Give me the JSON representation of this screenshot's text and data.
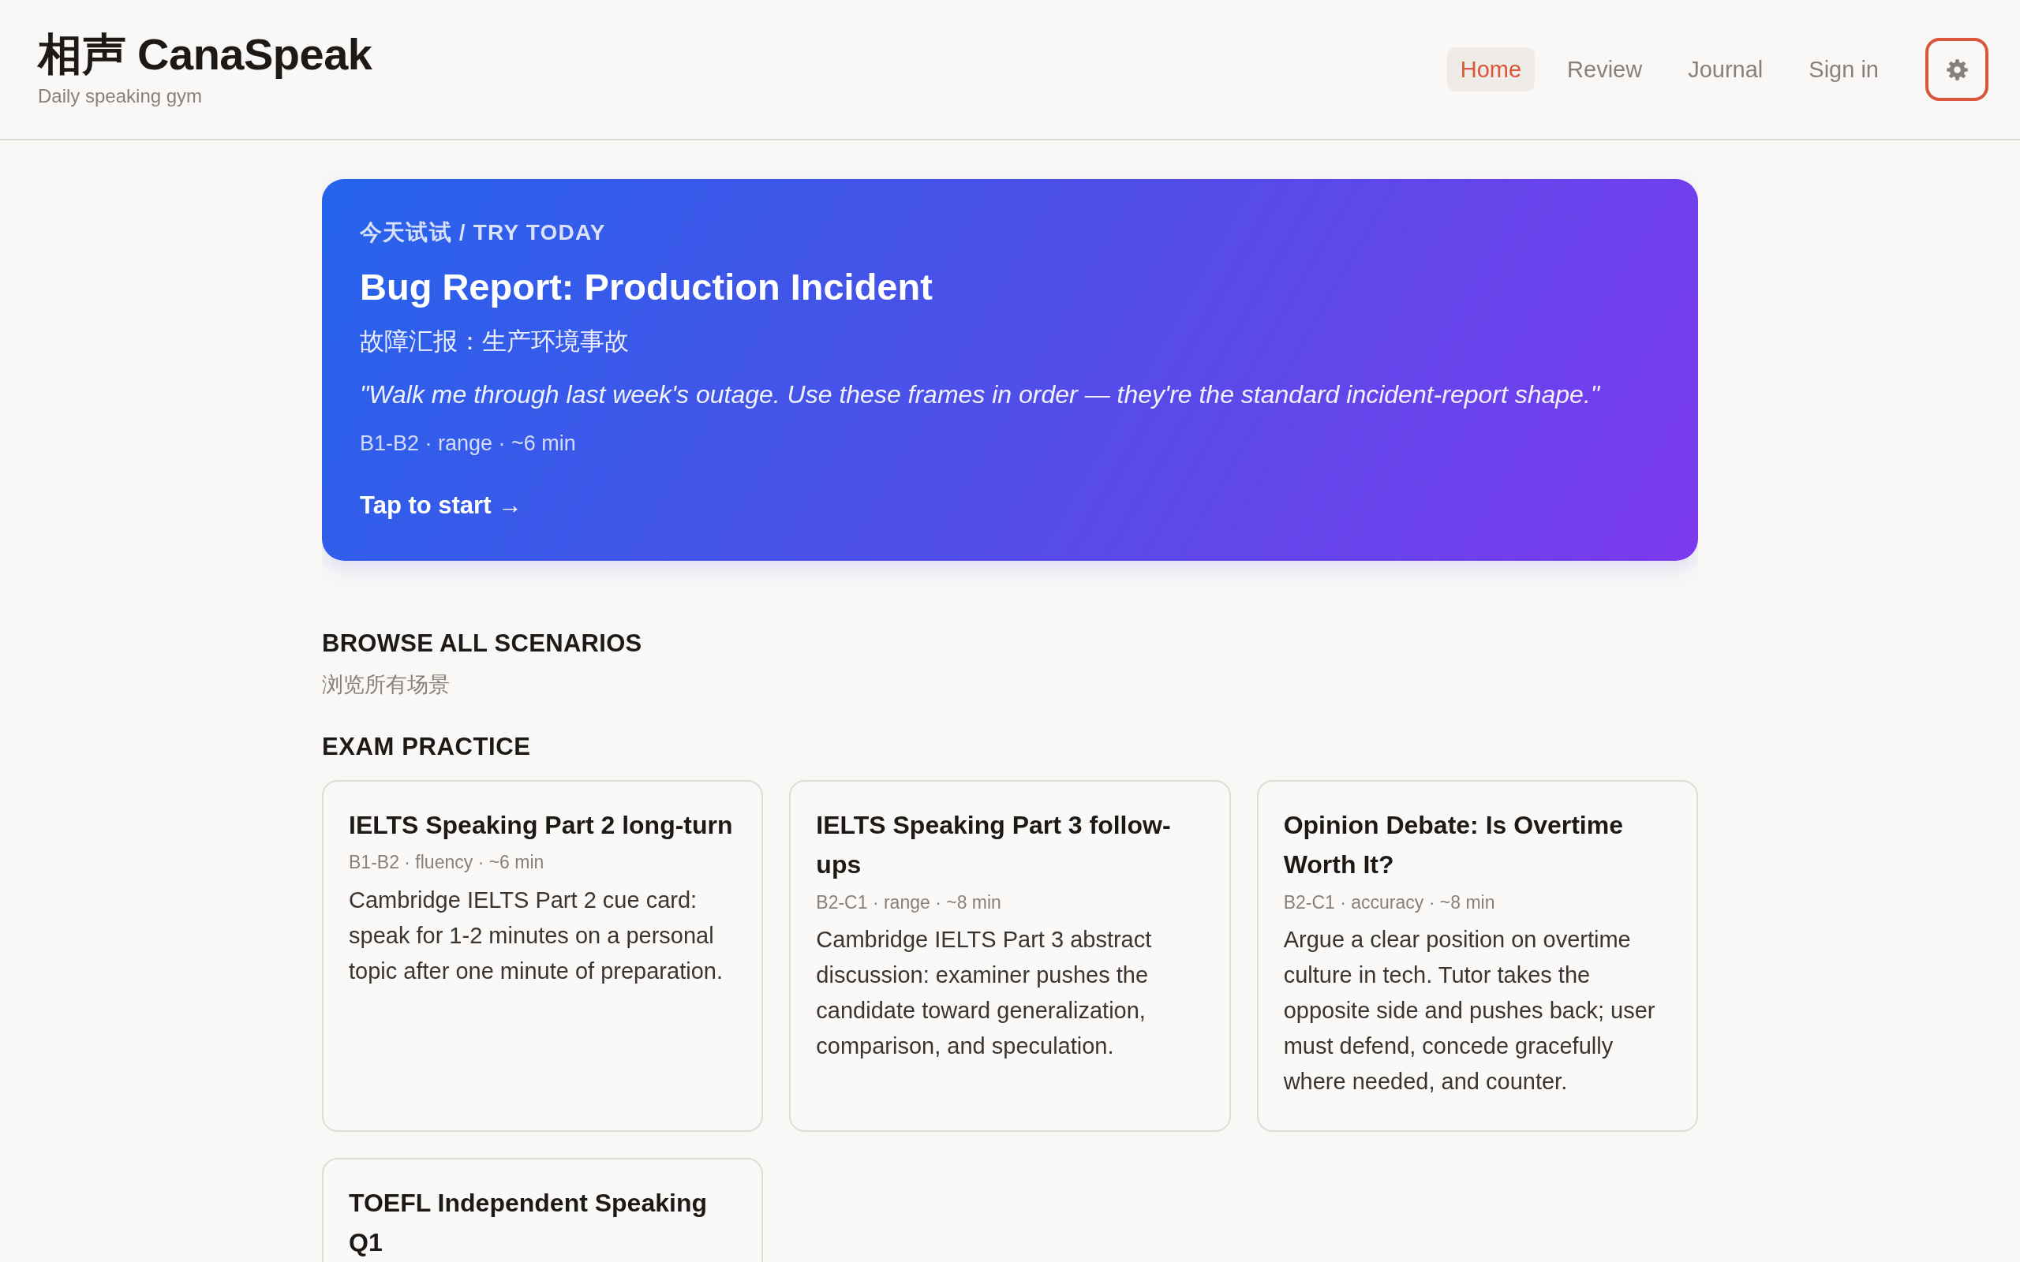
{
  "header": {
    "logo": "相声 CanaSpeak",
    "tagline": "Daily speaking gym"
  },
  "nav": {
    "items": [
      {
        "label": "Home",
        "selected": true
      },
      {
        "label": "Review",
        "selected": false
      },
      {
        "label": "Journal",
        "selected": false
      },
      {
        "label": "Sign in",
        "selected": false
      }
    ],
    "settings_button": {
      "focused": true
    }
  },
  "hero": {
    "eyebrow": "今天试试 / TRY TODAY",
    "title": "Bug Report: Production Incident",
    "subtitle": "故障汇报：生产环境事故",
    "quote": "\"Walk me through last week's outage. Use these frames in order — they're the standard incident-report shape.\"",
    "meta": "B1-B2 · range · ~6 min",
    "cta": "Tap to start →"
  },
  "browse": {
    "heading": "BROWSE ALL SCENARIOS",
    "subheading": "浏览所有场景"
  },
  "sections": [
    {
      "heading": "EXAM PRACTICE",
      "cards": [
        {
          "title": "IELTS Speaking Part 2 long-turn",
          "meta": "B1-B2 · fluency · ~6 min",
          "description": "Cambridge IELTS Part 2 cue card: speak for 1-2 minutes on a personal topic after one minute of preparation."
        },
        {
          "title": "IELTS Speaking Part 3 follow-ups",
          "meta": "B2-C1 · range · ~8 min",
          "description": "Cambridge IELTS Part 3 abstract discussion: examiner pushes the candidate toward generalization, comparison, and speculation."
        },
        {
          "title": "Opinion Debate: Is Overtime Worth It?",
          "meta": "B2-C1 · accuracy · ~8 min",
          "description": "Argue a clear position on overtime culture in tech. Tutor takes the opposite side and pushes back; user must defend, concede gracefully where needed, and counter."
        },
        {
          "title": "TOEFL Independent Speaking Q1"
        }
      ]
    }
  ]
}
